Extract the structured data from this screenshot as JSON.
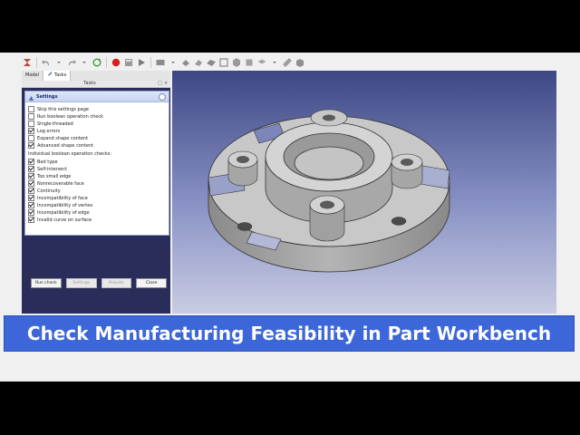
{
  "panel": {
    "tabs": [
      {
        "label": "Model"
      },
      {
        "label": "Tasks"
      }
    ],
    "header_title": "Tasks",
    "settings": {
      "title": "Settings",
      "options": [
        {
          "label": "Skip this settings page",
          "checked": false
        },
        {
          "label": "Run boolean operation check",
          "checked": false
        },
        {
          "label": "Single-threaded",
          "checked": false
        },
        {
          "label": "Log errors",
          "checked": true
        },
        {
          "label": "Expand shape content",
          "checked": false
        },
        {
          "label": "Advanced shape content",
          "checked": true
        }
      ],
      "boolean_checks_label": "Individual boolean operation checks:",
      "boolean_checks": [
        {
          "label": "Bad type",
          "checked": true
        },
        {
          "label": "Self-intersect",
          "checked": true
        },
        {
          "label": "Too small edge",
          "checked": true
        },
        {
          "label": "Nonrecoverable face",
          "checked": true
        },
        {
          "label": "Continuity",
          "checked": true
        },
        {
          "label": "Incompatibility of face",
          "checked": true
        },
        {
          "label": "Incompatibility of vertex",
          "checked": true
        },
        {
          "label": "Incompatibility of edge",
          "checked": true
        },
        {
          "label": "Invalid curve on surface",
          "checked": true
        }
      ]
    },
    "buttons": {
      "run_check": "Run check",
      "settings": "Settings",
      "results": "Results",
      "close": "Close"
    }
  },
  "banner": {
    "text": "Check Manufacturing Feasibility in Part Workbench"
  },
  "colors": {
    "banner": "#3d66d8",
    "panel_bg": "#2a2d5a",
    "viewport_top": "#3d4784",
    "viewport_bottom": "#c9cce3",
    "part_face": "#c8c8c8"
  }
}
